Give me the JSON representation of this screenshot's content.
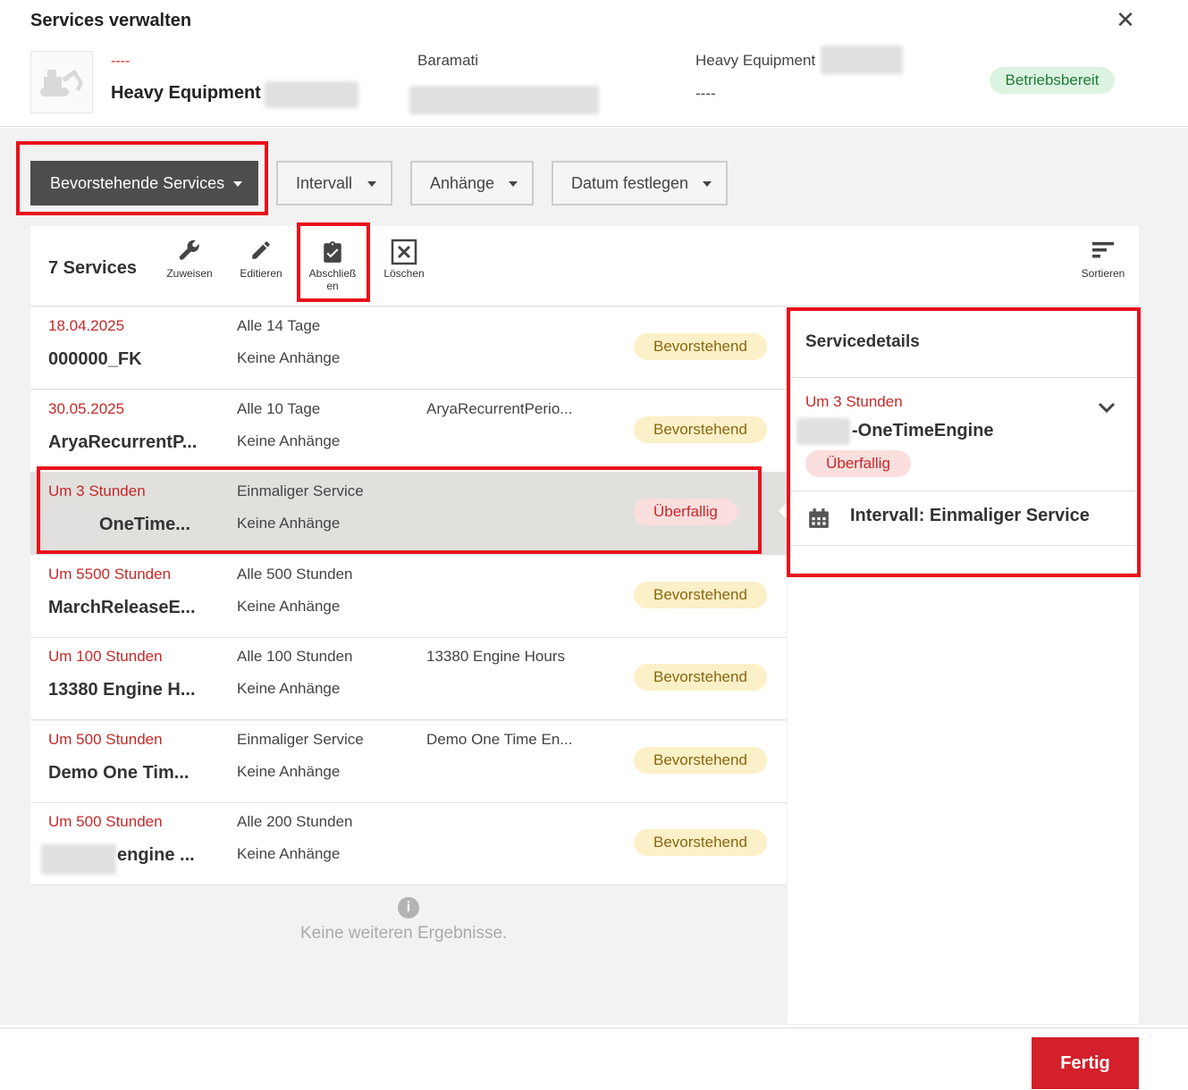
{
  "dialog": {
    "title": "Services verwalten",
    "close_icon": "close-icon"
  },
  "equipment": {
    "image_icon": "excavator-icon",
    "label_dash": "----",
    "name": "Heavy Equipment",
    "location": "Baramati",
    "type": "Heavy Equipment",
    "type_sub": "----",
    "status": "Betriebsbereit"
  },
  "filters": [
    {
      "label": "Bevorstehende Services"
    },
    {
      "label": "Intervall"
    },
    {
      "label": "Anhänge"
    },
    {
      "label": "Datum festlegen"
    }
  ],
  "toolbar": {
    "count": "7 Services",
    "assign": "Zuweisen",
    "edit": "Editieren",
    "complete_line1": "Abschließ",
    "complete_line2": "en",
    "delete": "Löschen",
    "sort": "Sortieren"
  },
  "services": [
    {
      "date": "18.04.2025",
      "name": "000000_FK",
      "interval": "Alle 14 Tage",
      "attachments": "Keine Anhänge",
      "extra": "",
      "status": "Bevorstehend"
    },
    {
      "date": "30.05.2025",
      "name": "AryaRecurrentP...",
      "interval": "Alle 10 Tage",
      "attachments": "Keine Anhänge",
      "extra": "AryaRecurrentPerio...",
      "status": "Bevorstehend"
    },
    {
      "date": "Um 3 Stunden",
      "name": "OneTime...",
      "interval": "Einmaliger Service",
      "attachments": "Keine Anhänge",
      "extra": "",
      "status": "Überfallig"
    },
    {
      "date": "Um 5500 Stunden",
      "name": "MarchReleaseE...",
      "interval": "Alle 500 Stunden",
      "attachments": "Keine Anhänge",
      "extra": "",
      "status": "Bevorstehend"
    },
    {
      "date": "Um 100 Stunden",
      "name": "13380 Engine H...",
      "interval": "Alle 100 Stunden",
      "attachments": "Keine Anhänge",
      "extra": "13380 Engine Hours",
      "status": "Bevorstehend"
    },
    {
      "date": "Um 500 Stunden",
      "name": "Demo One Tim...",
      "interval": "Einmaliger Service",
      "attachments": "Keine Anhänge",
      "extra": "Demo One Time En...",
      "status": "Bevorstehend"
    },
    {
      "date": "Um 500 Stunden",
      "name": "engine ...",
      "interval": "Alle 200 Stunden",
      "attachments": "Keine Anhänge",
      "extra": "",
      "status": "Bevorstehend"
    }
  ],
  "no_more": "Keine weiteren Ergebnisse.",
  "details": {
    "title": "Servicedetails",
    "date": "Um 3 Stunden",
    "name": "-OneTimeEngine",
    "status": "Überfallig",
    "interval": "Intervall: Einmaliger Service"
  },
  "footer": {
    "done": "Fertig"
  },
  "colors": {
    "accent_red": "#d3202a",
    "highlight_box": "#e8101b",
    "upcoming_bg": "#fcf0c8",
    "overdue_bg": "#fbdede",
    "ready_bg": "#dcf3e1"
  }
}
